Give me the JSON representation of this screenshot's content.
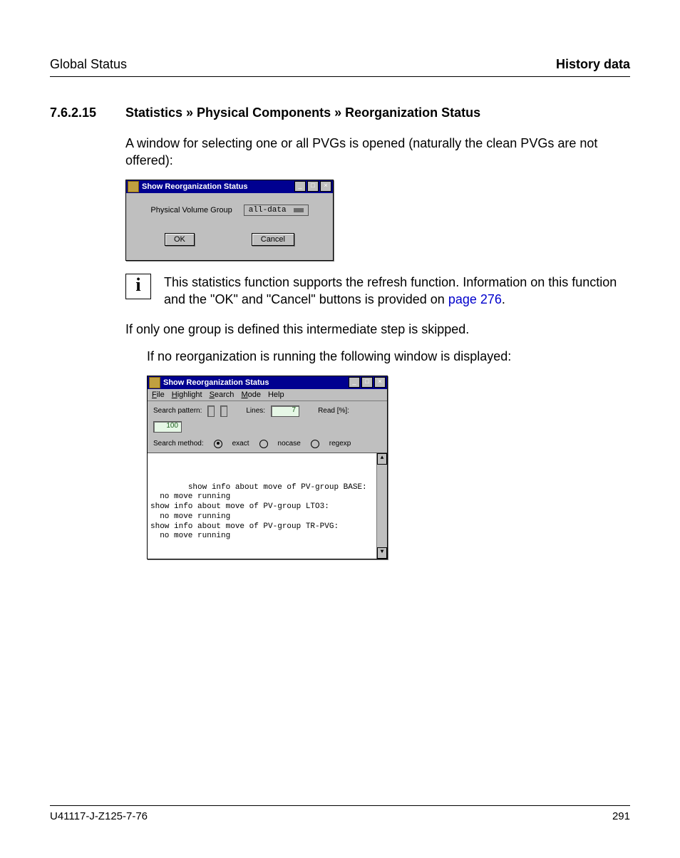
{
  "header": {
    "left": "Global Status",
    "right": "History data"
  },
  "section": {
    "number": "7.6.2.15",
    "title": "Statistics » Physical Components » Reorganization Status"
  },
  "para1": "A  window for selecting one or all PVGs is opened (naturally the clean PVGs are not offered):",
  "dialog1": {
    "title": "Show Reorganization Status",
    "field_label": "Physical Volume Group",
    "dropdown_value": "all-data",
    "ok": "OK",
    "cancel": "Cancel"
  },
  "note": {
    "text_a": "This statistics function supports the refresh function. Information on this function and the \"OK\" and \"Cancel\" buttons is provided on ",
    "link": "page 276",
    "text_b": "."
  },
  "para2": "If only one group is defined this intermediate step is skipped.",
  "para3": "If no reorganization is running the following window is displayed:",
  "dialog2": {
    "title": "Show Reorganization Status",
    "menus": {
      "file": "File",
      "highlight": "Highlight",
      "search": "Search",
      "mode": "Mode",
      "help": "Help"
    },
    "search_pattern_label": "Search pattern:",
    "lines_label": "Lines:",
    "lines_value": "7",
    "read_label": "Read [%]:",
    "read_value": "100",
    "method_label": "Search method:",
    "methods": {
      "exact": "exact",
      "nocase": "nocase",
      "regexp": "regexp"
    },
    "output": "show info about move of PV-group BASE:\n  no move running\nshow info about move of PV-group LTO3:\n  no move running\nshow info about move of PV-group TR-PVG:\n  no move running"
  },
  "footer": {
    "doc_id": "U41117-J-Z125-7-76",
    "page": "291"
  }
}
